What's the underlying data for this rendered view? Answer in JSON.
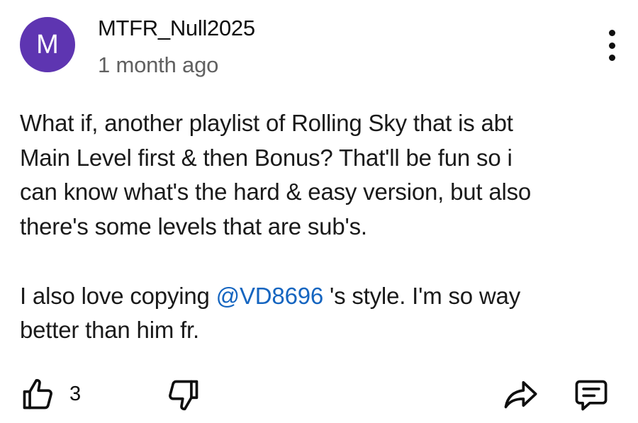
{
  "comment": {
    "avatar_initial": "M",
    "avatar_color": "#5e35b1",
    "username": "MTFR_Null2025",
    "timestamp": "1 month ago",
    "paragraph_1": "What if, another playlist of Rolling Sky that is abt\nMain Level first & then Bonus? That'll be fun so i\ncan know what's the hard & easy version, but also\nthere's some levels that are sub's.",
    "paragraph_2_before": "I also love copying ",
    "mention": "@VD8696",
    "paragraph_2_after": " 's style. I'm so way\nbetter than him fr.",
    "mention_color": "#1565c0"
  },
  "actions": {
    "like_count": "3",
    "icons": [
      "thumbs-up-icon",
      "thumbs-down-icon",
      "share-icon",
      "reply-icon",
      "more-vert-icon"
    ]
  }
}
